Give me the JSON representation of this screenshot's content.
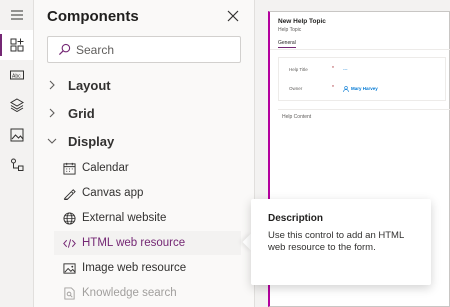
{
  "panel": {
    "title": "Components",
    "search_placeholder": "Search"
  },
  "groups": [
    {
      "label": "Layout",
      "expanded": false
    },
    {
      "label": "Grid",
      "expanded": false
    },
    {
      "label": "Display",
      "expanded": true
    }
  ],
  "display_items": [
    {
      "label": "Calendar",
      "icon": "calendar-icon"
    },
    {
      "label": "Canvas app",
      "icon": "canvas-app-icon"
    },
    {
      "label": "External website",
      "icon": "globe-icon"
    },
    {
      "label": "HTML web resource",
      "icon": "code-icon"
    },
    {
      "label": "Image web resource",
      "icon": "image-icon"
    },
    {
      "label": "Knowledge search",
      "icon": "knowledge-search-icon"
    }
  ],
  "tooltip": {
    "heading": "Description",
    "body": "Use this control to add an HTML web resource to the form."
  },
  "form": {
    "title": "New Help Topic",
    "subtitle": "Help Topic",
    "tab": "General",
    "fields": [
      {
        "label": "Help Title",
        "required": "*",
        "value": "---"
      },
      {
        "label": "Owner",
        "required": "*",
        "value": "Mary Harvey"
      }
    ],
    "content_label": "Help Content"
  },
  "colors": {
    "accent": "#742774",
    "form_accent": "#b4009e",
    "link": "#0078d4"
  }
}
